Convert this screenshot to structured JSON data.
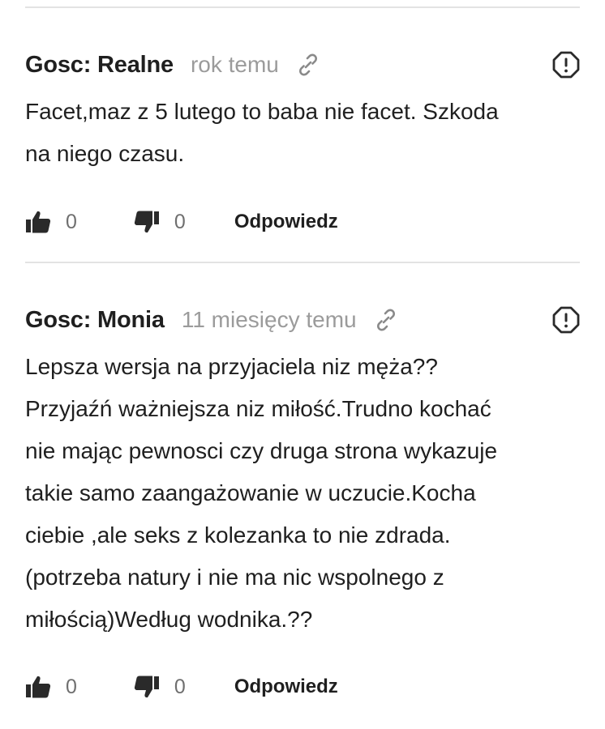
{
  "comments": [
    {
      "author": "Gosc: Realne",
      "time": "rok temu",
      "text": "Facet,maz z 5 lutego to baba nie facet. Szkoda\nna niego czasu.",
      "likes": "0",
      "dislikes": "0",
      "reply_label": "Odpowiedz"
    },
    {
      "author": "Gosc: Monia",
      "time": "11 miesięcy temu",
      "text": "Lepsza wersja na przyjaciela niz męża??\nPrzyjaźń ważniejsza niz miłość.Trudno kochać\nnie mając pewnosci czy druga strona wykazuje\ntakie samo zaangażowanie w uczucie.Kocha\nciebie ,ale seks z kolezanka to nie zdrada.\n(potrzeba natury i nie ma nic wspolnego z\nmiłością)Według wodnika.??",
      "likes": "0",
      "dislikes": "0",
      "reply_label": "Odpowiedz"
    }
  ],
  "icons": {
    "link": "link-icon",
    "report": "report-icon",
    "thumbs_up": "thumbs-up-icon",
    "thumbs_down": "thumbs-down-icon"
  },
  "colors": {
    "text": "#1f1f1f",
    "muted": "#9b9b9b",
    "count": "#6f6f6f",
    "divider": "#e3e3e3"
  }
}
